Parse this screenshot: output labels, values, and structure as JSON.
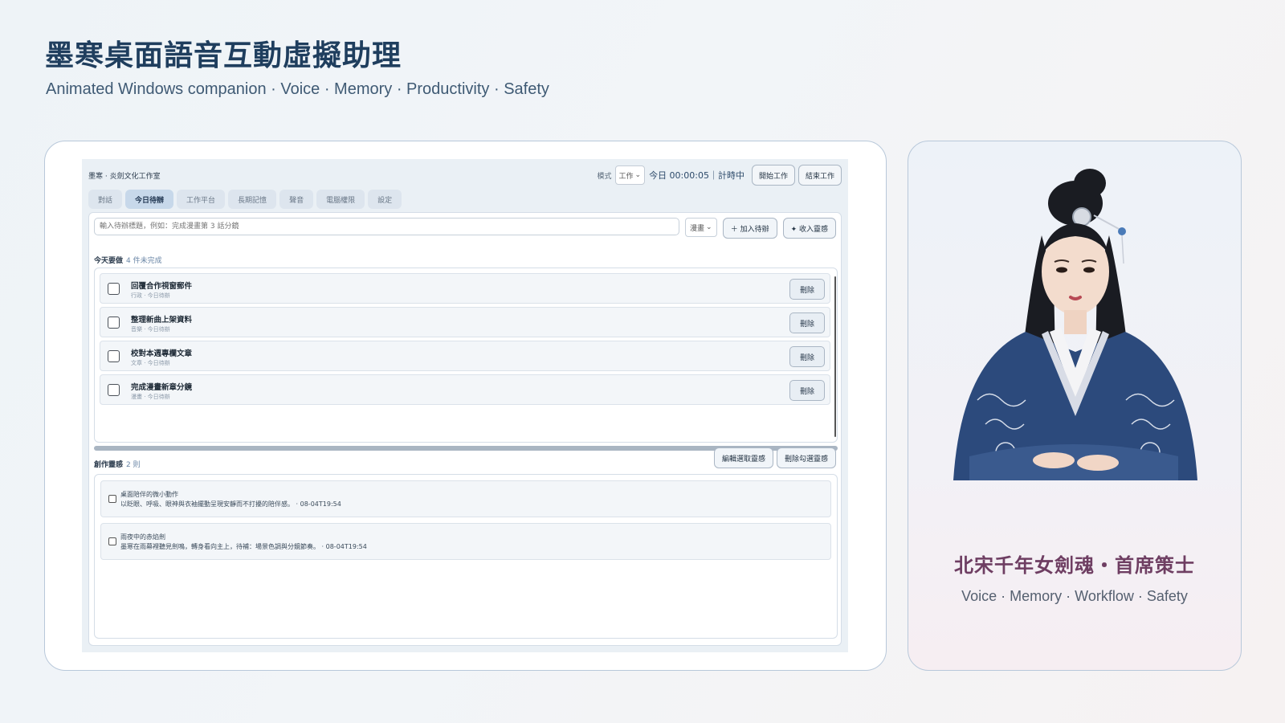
{
  "page": {
    "title": "墨寒桌面語音互動虛擬助理",
    "subtitle": "Animated Windows companion · Voice · Memory · Productivity · Safety"
  },
  "app": {
    "studio_name": "墨寒 · 炎劍文化工作室",
    "mode_label": "模式",
    "mode_value": "工作",
    "timer": "今日 00:00:05｜計時中",
    "start_button": "開始工作",
    "end_button": "結束工作",
    "tabs": [
      {
        "label": "對話",
        "active": false
      },
      {
        "label": "今日待辦",
        "active": true
      },
      {
        "label": "工作平台",
        "active": false
      },
      {
        "label": "長期記憶",
        "active": false
      },
      {
        "label": "聲音",
        "active": false
      },
      {
        "label": "電腦權限",
        "active": false
      },
      {
        "label": "設定",
        "active": false
      }
    ],
    "todo_input_placeholder": "輸入待辦標題，例如：完成漫畫第 3 話分鏡",
    "category_value": "漫畫",
    "add_todo_button": "＋ 加入待辦",
    "inspiration_button": "✦ 收入靈感",
    "today_heading": "今天要做",
    "today_count": "4 件未完成",
    "todos": [
      {
        "title": "回覆合作視窗郵件",
        "meta": "行政 · 今日待辦",
        "delete": "刪除"
      },
      {
        "title": "整理新曲上架資料",
        "meta": "音樂 · 今日待辦",
        "delete": "刪除"
      },
      {
        "title": "校對本週專欄文章",
        "meta": "文章 · 今日待辦",
        "delete": "刪除"
      },
      {
        "title": "完成漫畫新章分鏡",
        "meta": "漫畫 · 今日待辦",
        "delete": "刪除"
      }
    ],
    "inspiration_heading": "創作靈感",
    "inspiration_count": "2 則",
    "edit_inspiration_button": "編輯選取靈感",
    "delete_inspiration_button": "刪除勾選靈感",
    "inspirations": [
      {
        "title": "桌面陪伴的微小動作",
        "desc": "以眨眼、呼吸、眼神與衣袖擺動呈現安靜而不打擾的陪伴感。 · 08-04T19:54"
      },
      {
        "title": "雨夜中的赤焰劍",
        "desc": "墨寒在雨幕裡聽見劍鳴，轉身看向主上，待補：場景色調與分鏡節奏。 · 08-04T19:54"
      }
    ]
  },
  "character": {
    "title": "北宋千年女劍魂・首席策士",
    "subtitle": "Voice · Memory · Workflow · Safety",
    "portrait_icon": "character-portrait"
  },
  "colors": {
    "title": "#1f3e5e",
    "character_title": "#6e3e62",
    "robe": "#2c4a7c",
    "card_border": "#b8c8da"
  }
}
